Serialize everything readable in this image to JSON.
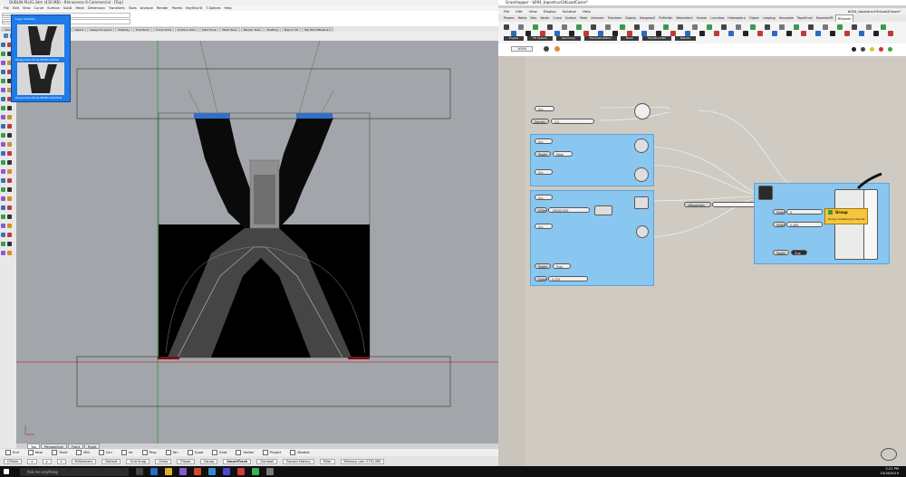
{
  "rhino": {
    "title": "DUBLIN-PLUG.3dm (416 MB) - Rhinoceros 6 Commercial - [Top]",
    "menu": [
      "File",
      "Edit",
      "View",
      "Curve",
      "Surface",
      "SubD",
      "Mesh",
      "Dimension",
      "Transform",
      "Tools",
      "Analyze",
      "Render",
      "Panels",
      "KeyShot 8",
      "T-Splines",
      "Help"
    ],
    "command_lines": [
      "Command: _Delete",
      "Command:"
    ],
    "toolbar_tabs": [
      "Standard",
      "CPlanes",
      "Set View",
      "Display",
      "Select",
      "Viewport Layout",
      "Visibility",
      "Transform",
      "Curve Tools",
      "Surface Tools",
      "Solid Tools",
      "Mesh Tools",
      "Render Tools",
      "Drafting",
      "New in V6",
      "Top Part Offsets 2.1"
    ],
    "viewport_tabs": [
      "Perspective",
      "Front",
      "Right"
    ],
    "active_viewport_tab": "Top",
    "osnaps": [
      "End",
      "Near",
      "Point",
      "Mid",
      "Cen",
      "Int",
      "Perp",
      "Tan",
      "Quad",
      "Knot",
      "Vertex",
      "Project",
      "Disable"
    ],
    "status": [
      "CPlane",
      "x",
      "y",
      "z",
      "Millimeters",
      "Default",
      "Grid Snap",
      "Ortho",
      "Planar",
      "Osnap",
      "SmartTrack",
      "Gumball",
      "Record History",
      "Filter",
      "Memory use: 2751 MB"
    ],
    "popup": {
      "title": "Layer Visibility",
      "captions": [
        "Perspective PLUG-INDEX-100CM",
        "Perspective PLUG-INDEX-100CM-B"
      ]
    }
  },
  "gh": {
    "title": "Grasshopper - b004_topostruct3dLoadCases*",
    "doc_name": "b004_topostruct3dLoadCases*",
    "menu": [
      "File",
      "Edit",
      "View",
      "Display",
      "Solution",
      "Help"
    ],
    "tabs": [
      "Params",
      "Maths",
      "Sets",
      "Vector",
      "Curve",
      "Surface",
      "Mesh",
      "Intersect",
      "Transform",
      "Display",
      "Kangaroo2",
      "Pufferfish",
      "Weaverbird",
      "Human",
      "Lunchbox",
      "Heteroptera",
      "Clipper",
      "Ladybug",
      "Honeybee",
      "TopoStruct",
      "Karamba3D",
      "Millipede"
    ],
    "active_tab": "Millipede",
    "ribbon_groups": [
      "Engine",
      "FE System",
      "Geometry",
      "Parametrization",
      "Mesh",
      "TopoStruct3D",
      "Results"
    ],
    "zoom": "100%",
    "nodes": {
      "crv_1": "Crv",
      "density_label": "Density",
      "density_value": "0.5",
      "crv_2": "Crv",
      "toggle_1": "Toggle",
      "toggle_1_value": "False",
      "crv_3": "Crv",
      "crv_4": "Crv",
      "slider_1_label": "Slider",
      "slider_1_value": "-50000.000",
      "crv_5": "Crv",
      "toggle_2": "Toggle",
      "toggle_2_value": "True",
      "slider_2_label": "Slider",
      "slider_2_value": "0.375",
      "resolution_label": "nResolution",
      "resolution_value": "100",
      "slider_3_label": "Slider",
      "slider_3_value": "5",
      "slider_4_label": "Slider",
      "slider_4_value": "0.400",
      "toggle_3": "Toggle",
      "toggle_3_value": "True"
    },
    "tooltip": {
      "title": "Group",
      "body": "Group containing 6 objects"
    }
  },
  "taskbar": {
    "search_placeholder": "Ask me anything",
    "time": "2:22 PM",
    "date": "10/16/2019"
  }
}
